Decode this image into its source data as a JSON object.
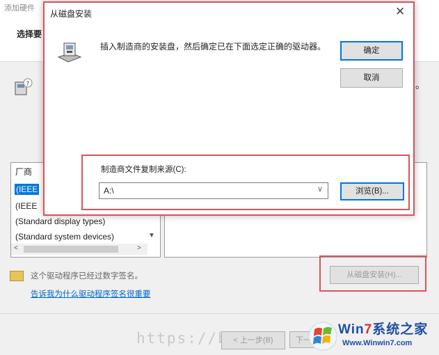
{
  "background_window": {
    "title": "添加硬件",
    "heading": "选择要",
    "trailing_text": "。",
    "manufacturer_header": "厂商",
    "manufacturers": [
      "(IEEE",
      "(IEEE",
      "(Standard display types)",
      "(Standard system devices)"
    ],
    "signing_text": "这个驱动程序已经过数字签名。",
    "signing_link": "告诉我为什么驱动程序签名很重要",
    "have_disk_button": "从磁盘安装(H)...",
    "back_button": "< 上一步(B)",
    "next_button": "下一",
    "watermark_url": "https://bl"
  },
  "dialog": {
    "title": "从磁盘安装",
    "close_glyph": "✕",
    "instruction": "插入制造商的安装盘，然后确定已在下面选定正确的驱动器。",
    "ok_button": "确定",
    "cancel_button": "取消",
    "copy_from_label": "制造商文件复制来源(C):",
    "copy_from_value": "A:\\",
    "browse_button": "浏览(B)...",
    "chevron_glyph": "∨"
  },
  "logo": {
    "title_prefix": "Win",
    "title_seven": "7",
    "title_suffix": "系统之家",
    "url": "Www.Winwin7.com"
  },
  "colors": {
    "highlight": "#d9535a",
    "selection": "#0078d7",
    "link": "#0066cc"
  }
}
